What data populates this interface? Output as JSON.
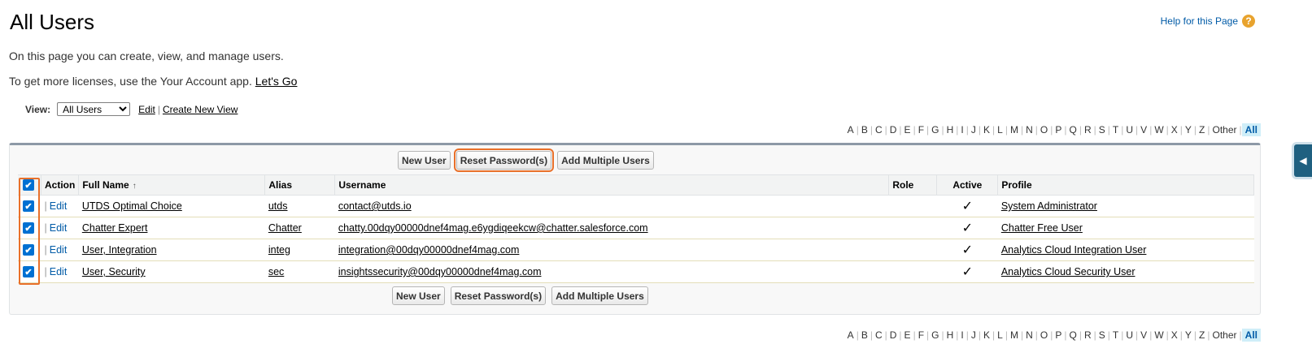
{
  "header": {
    "title": "All Users",
    "help_label": "Help for this Page",
    "help_icon": "?"
  },
  "intro": {
    "line1": "On this page you can create, view, and manage users.",
    "line2_prefix": "To get more licenses, use the Your Account app.",
    "line2_link": "Let's Go"
  },
  "view": {
    "label": "View:",
    "selected": "All Users",
    "edit_label": "Edit",
    "separator": "|",
    "create_label": "Create New View"
  },
  "alphabet": {
    "letters": [
      "A",
      "B",
      "C",
      "D",
      "E",
      "F",
      "G",
      "H",
      "I",
      "J",
      "K",
      "L",
      "M",
      "N",
      "O",
      "P",
      "Q",
      "R",
      "S",
      "T",
      "U",
      "V",
      "W",
      "X",
      "Y",
      "Z",
      "Other"
    ],
    "all_label": "All"
  },
  "buttons": {
    "new_user": "New User",
    "reset_password": "Reset Password(s)",
    "add_multiple": "Add Multiple Users"
  },
  "table": {
    "columns": {
      "action": "Action",
      "full_name": "Full Name",
      "sort_indicator": "↑",
      "alias": "Alias",
      "username": "Username",
      "role": "Role",
      "active": "Active",
      "profile": "Profile"
    },
    "edit_label": "Edit",
    "pipe": "|",
    "check_glyph": "✔",
    "rows": [
      {
        "full_name": "UTDS Optimal Choice",
        "alias": "utds",
        "username": "contact@utds.io",
        "role": "",
        "active": "✓",
        "profile": "System Administrator"
      },
      {
        "full_name": "Chatter Expert",
        "alias": "Chatter",
        "username": "chatty.00dqy00000dnef4mag.e6ygdiqeekcw@chatter.salesforce.com",
        "role": "",
        "active": "✓",
        "profile": "Chatter Free User"
      },
      {
        "full_name": "User, Integration",
        "alias": "integ",
        "username": "integration@00dqy00000dnef4mag.com",
        "role": "",
        "active": "✓",
        "profile": "Analytics Cloud Integration User"
      },
      {
        "full_name": "User, Security",
        "alias": "sec",
        "username": "insightssecurity@00dqy00000dnef4mag.com",
        "role": "",
        "active": "✓",
        "profile": "Analytics Cloud Security User"
      }
    ]
  },
  "colors": {
    "accent_blue": "#015ba7",
    "checkbox_blue": "#0070d2",
    "highlight_orange": "#e8702a",
    "panel_border": "#8d99a6"
  },
  "side_tab_icon": "◀"
}
